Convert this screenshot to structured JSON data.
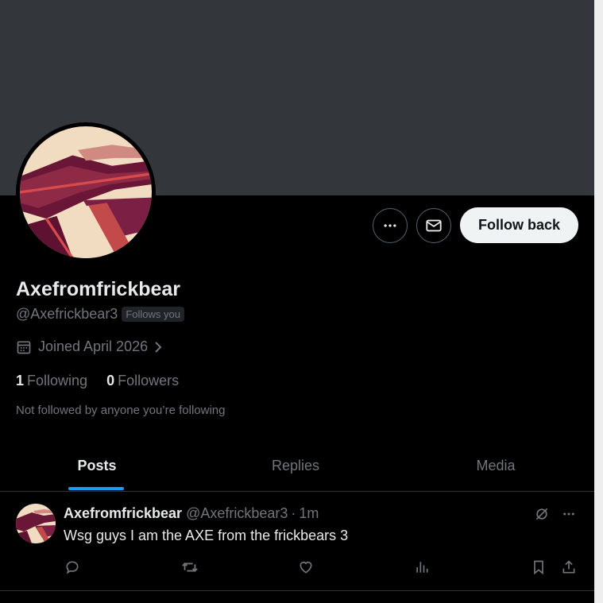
{
  "profile": {
    "display_name": "Axefromfrickbear",
    "handle": "@Axefrickbear3",
    "follows_you_badge": "Follows you",
    "joined": "Joined April 2026",
    "following_count": "1",
    "following_label": "Following",
    "followers_count": "0",
    "followers_label": "Followers",
    "not_followed_text": "Not followed by anyone you’re following"
  },
  "actions": {
    "more_icon": "more-horizontal-icon",
    "message_icon": "envelope-icon",
    "follow_back_label": "Follow back"
  },
  "tabs": [
    {
      "label": "Posts",
      "active": true
    },
    {
      "label": "Replies",
      "active": false
    },
    {
      "label": "Media",
      "active": false
    }
  ],
  "post": {
    "author_name": "Axefromfrickbear",
    "author_handle": "@Axefrickbear3",
    "separator": "·",
    "time": "1m",
    "text": "Wsg guys I am the AXE from the frickbears 3",
    "action_icons": [
      "reply-icon",
      "repost-icon",
      "like-icon",
      "views-icon",
      "bookmark-icon",
      "share-icon"
    ]
  },
  "colors": {
    "background": "#000000",
    "banner": "#33373b",
    "accent": "#1d9bf0",
    "muted_text": "#71767b",
    "primary_text": "#e7e9ea",
    "follow_button_bg": "#eff3f4"
  }
}
